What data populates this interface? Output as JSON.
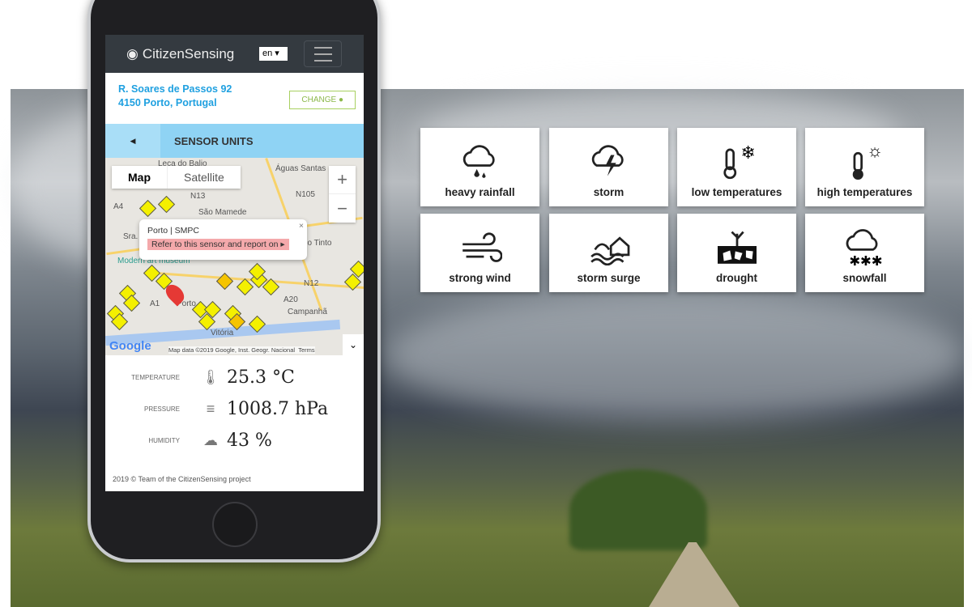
{
  "app": {
    "title": "CitizenSensing",
    "language": "en"
  },
  "address": {
    "line1": "R. Soares de Passos 92",
    "line2": "4150 Porto, Portugal",
    "change_label": "CHANGE"
  },
  "subheader": {
    "title": "SENSOR UNITS"
  },
  "map": {
    "type_map": "Map",
    "type_satellite": "Satellite",
    "zoom_in": "+",
    "zoom_out": "−",
    "labels": [
      "Leca do Balio",
      "Águas Santas",
      "São Mamede",
      "Sra.",
      "Rio Tinto",
      "Modern art museum",
      "Campanhã",
      "Vitória",
      "Porto",
      "N105",
      "N13",
      "N12",
      "A20",
      "A1",
      "A4"
    ],
    "popup": {
      "title": "Porto | SMPC",
      "link": "Refer to this sensor and report on"
    },
    "attribution": "Map data ©2019 Google, Inst. Geogr. Nacional",
    "terms": "Terms",
    "brand": "Google"
  },
  "readings": [
    {
      "label": "TEMPERATURE",
      "value": "25.3 °C",
      "icon": "thermometer-icon"
    },
    {
      "label": "PRESSURE",
      "value": "1008.7 hPa",
      "icon": "pressure-lines-icon"
    },
    {
      "label": "HUMIDITY",
      "value": "43 %",
      "icon": "humidity-cloud-icon"
    }
  ],
  "footer": "2019 © Team of the CitizenSensing project",
  "events": [
    {
      "label": "heavy rainfall",
      "icon": "heavy-rainfall-icon"
    },
    {
      "label": "storm",
      "icon": "storm-icon"
    },
    {
      "label": "low temperatures",
      "icon": "low-temperature-icon"
    },
    {
      "label": "high temperatures",
      "icon": "high-temperature-icon"
    },
    {
      "label": "strong wind",
      "icon": "strong-wind-icon"
    },
    {
      "label": "storm surge",
      "icon": "storm-surge-icon"
    },
    {
      "label": "drought",
      "icon": "drought-icon"
    },
    {
      "label": "snowfall",
      "icon": "snowfall-icon"
    }
  ],
  "colors": {
    "navbar": "#343a40",
    "address": "#1fa0e0",
    "subheader": "#8fd3f4",
    "change": "#8cb84a",
    "marker": "#f4f000",
    "popup_link": "#f4a9ab"
  }
}
